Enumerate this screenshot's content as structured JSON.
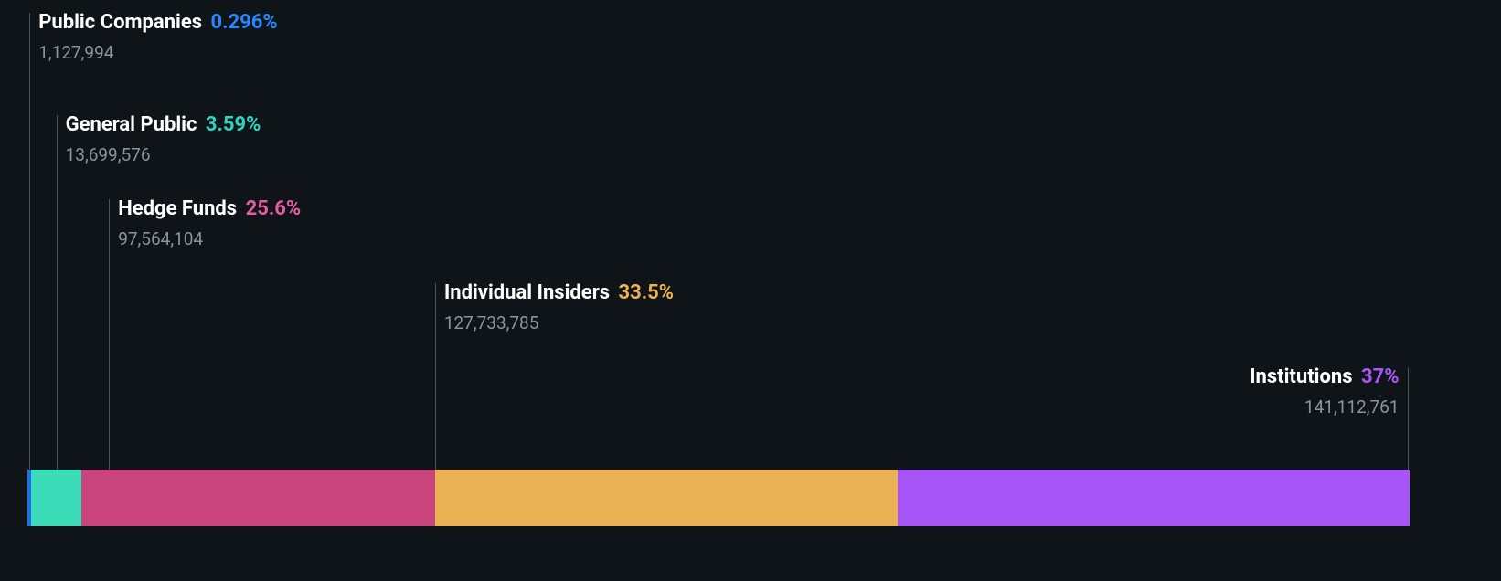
{
  "chart_data": {
    "type": "bar",
    "title": "",
    "xlabel": "",
    "ylabel": "",
    "series": [
      {
        "name": "Public Companies",
        "pct_label": "0.296%",
        "pct": 0.296,
        "value_label": "1,127,994",
        "value": 1127994,
        "color": "#1f6feb"
      },
      {
        "name": "General Public",
        "pct_label": "3.59%",
        "pct": 3.59,
        "value_label": "13,699,576",
        "value": 13699576,
        "color": "#3ddc97"
      },
      {
        "name": "Hedge Funds",
        "pct_label": "25.6%",
        "pct": 25.6,
        "value_label": "97,564,104",
        "value": 97564104,
        "color": "#c9437c"
      },
      {
        "name": "Individual Insiders",
        "pct_label": "33.5%",
        "pct": 33.5,
        "value_label": "127,733,785",
        "value": 127733785,
        "color": "#eab254"
      },
      {
        "name": "Institutions",
        "pct_label": "37%",
        "pct": 37.0,
        "value_label": "141,112,761",
        "value": 141112761,
        "color": "#a855f7"
      }
    ]
  }
}
